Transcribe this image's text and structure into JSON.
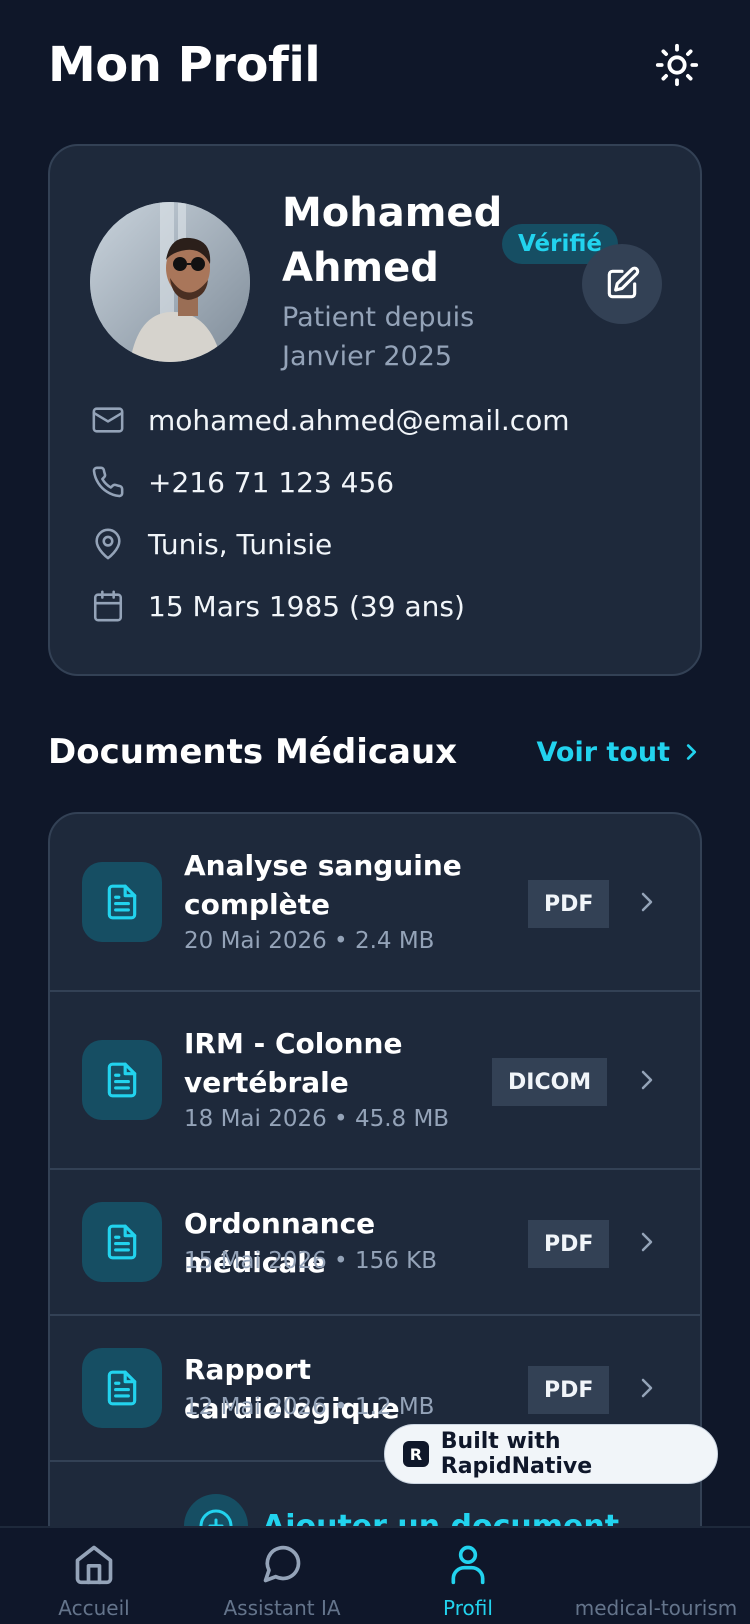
{
  "header": {
    "title": "Mon Profil",
    "theme_icon": "sun-icon"
  },
  "profile": {
    "name": "Mohamed Ahmed",
    "verified_label": "Vérifié",
    "patient_since": "Patient depuis Janvier 2025",
    "email": "mohamed.ahmed@email.com",
    "phone": "+216 71 123 456",
    "location": "Tunis, Tunisie",
    "birthdate": "15 Mars 1985 (39 ans)"
  },
  "documents": {
    "title": "Documents Médicaux",
    "see_all_label": "Voir tout",
    "items": [
      {
        "title": "Analyse sanguine complète",
        "meta": "20 Mai 2026 • 2.4 MB",
        "type": "PDF"
      },
      {
        "title": "IRM - Colonne vertébrale",
        "meta": "18 Mai 2026 • 45.8 MB",
        "type": "DICOM"
      },
      {
        "title": "Ordonnance médicale",
        "meta": "15 Mai 2026 • 156 KB",
        "type": "PDF"
      },
      {
        "title": "Rapport cardiologique",
        "meta": "12 Mai 2026 • 1.2 MB",
        "type": "PDF"
      }
    ],
    "add_label": "Ajouter un document"
  },
  "built_with": "Built with RapidNative",
  "nav": {
    "items": [
      {
        "label": "Accueil",
        "icon": "home-icon",
        "active": false
      },
      {
        "label": "Assistant IA",
        "icon": "chat-icon",
        "active": false
      },
      {
        "label": "Profil",
        "icon": "user-icon",
        "active": true
      },
      {
        "label": "medical-tourism",
        "icon": "",
        "active": false
      }
    ]
  },
  "colors": {
    "background": "#0f1729",
    "card": "#1e293b",
    "accent": "#22d3ee",
    "muted": "#94a3b8"
  }
}
